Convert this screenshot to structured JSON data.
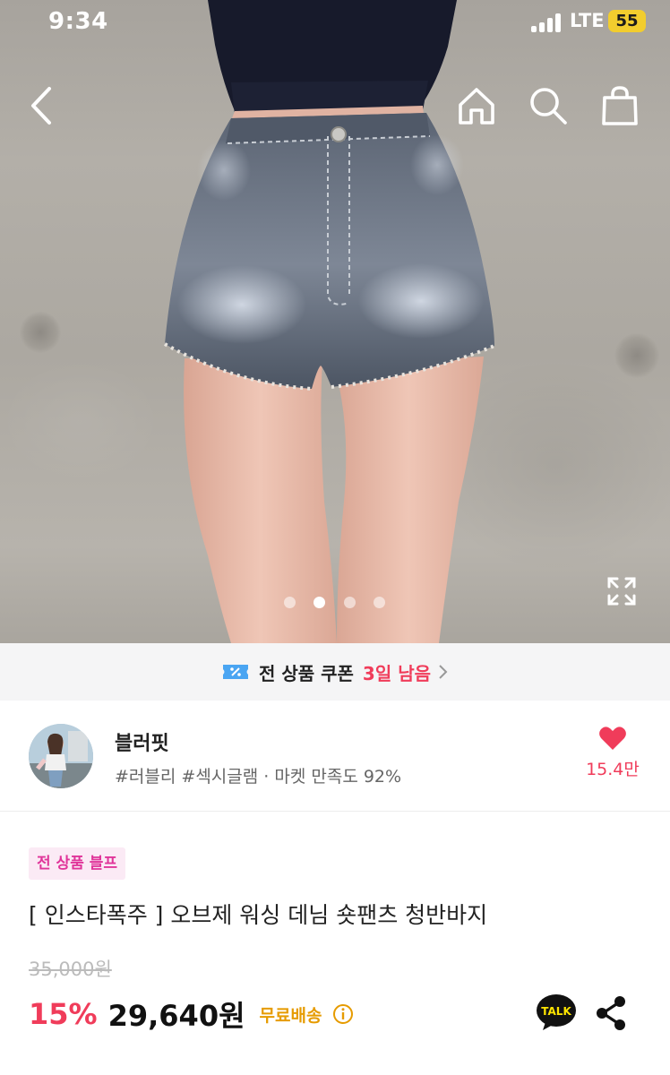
{
  "status_bar": {
    "time": "9:34",
    "network": "LTE",
    "battery": "55"
  },
  "header": {
    "icons": [
      "back-arrow-icon",
      "home-icon",
      "search-icon",
      "shopping-bag-icon"
    ]
  },
  "gallery": {
    "image_count": 4,
    "active_index": 1
  },
  "coupon": {
    "label": "전 상품 쿠폰",
    "remaining": "3일 남음"
  },
  "shop": {
    "name": "블러핏",
    "tags": "#러블리 #섹시글램 · 마켓 만족도 92%",
    "likes": "15.4만"
  },
  "product": {
    "badge": "전 상품 블프",
    "title": "[ 인스타폭주 ] 오브제 워싱 데님 숏팬츠 청반바지",
    "original_price": "35,000원",
    "discount": "15%",
    "price": "29,640원",
    "shipping": "무료배송"
  },
  "actions": {
    "talk_label": "TALK"
  },
  "colors": {
    "accent_red": "#f03c5a",
    "badge_pink": "#e0359a",
    "badge_bg": "#fbeaf5",
    "shipping_gold": "#e69b00",
    "kakao_yellow": "#fee500"
  }
}
